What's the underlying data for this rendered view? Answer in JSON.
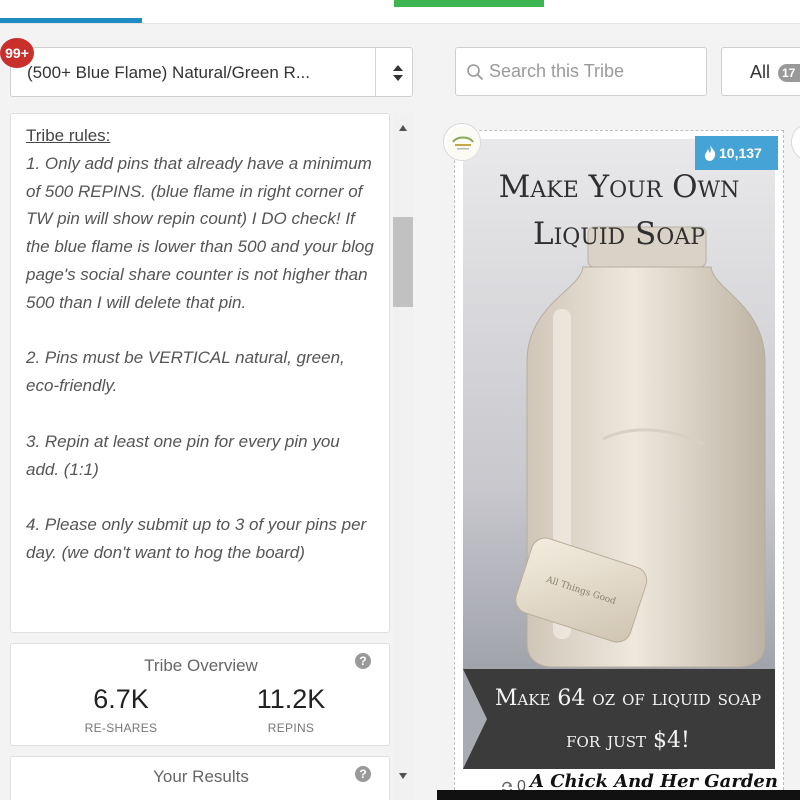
{
  "header": {
    "colors": {
      "tab_indicator": "#1e8bc3",
      "action_button": "#3cb552"
    }
  },
  "tribe_selector": {
    "notification_badge": "99+",
    "selected_value": "(500+ Blue Flame) Natural/Green R...",
    "arrows_icon": "sort-arrows-icon"
  },
  "search": {
    "placeholder": "Search this Tribe",
    "icon": "search-icon"
  },
  "filter": {
    "label": "All",
    "count_partial": "17"
  },
  "rules": {
    "heading": "Tribe rules:",
    "paragraphs": [
      "1. Only add pins that already have a minimum of 500 REPINS. (blue flame in right corner of TW pin will show repin count) I DO check! If the blue flame is lower than 500 and your blog page's social share counter is not higher than 500 than I will delete that pin.",
      "2. Pins must be VERTICAL natural, green, eco-friendly.",
      "3. Repin at least one pin for every pin you add. (1:1)",
      "4. Please only submit up to 3 of your pins per day. (we don't want to hog the board)"
    ]
  },
  "overview": {
    "title": "Tribe Overview",
    "stats": [
      {
        "value": "6.7K",
        "label": "RE-SHARES"
      },
      {
        "value": "11.2K",
        "label": "REPINS"
      }
    ]
  },
  "results": {
    "title": "Your Results"
  },
  "help_icon_glyph": "?",
  "pin": {
    "repins": "10,137",
    "title": "Make Your Own Liquid Soap",
    "soap_stamp": "All Things Good",
    "banner_text": "Make 64 oz of liquid soap for just $4!",
    "watermark": "A Chick And Her Garden",
    "repin_count": "0",
    "colors": {
      "badge": "#46a3d6",
      "banner": "#3b3b3b"
    }
  }
}
